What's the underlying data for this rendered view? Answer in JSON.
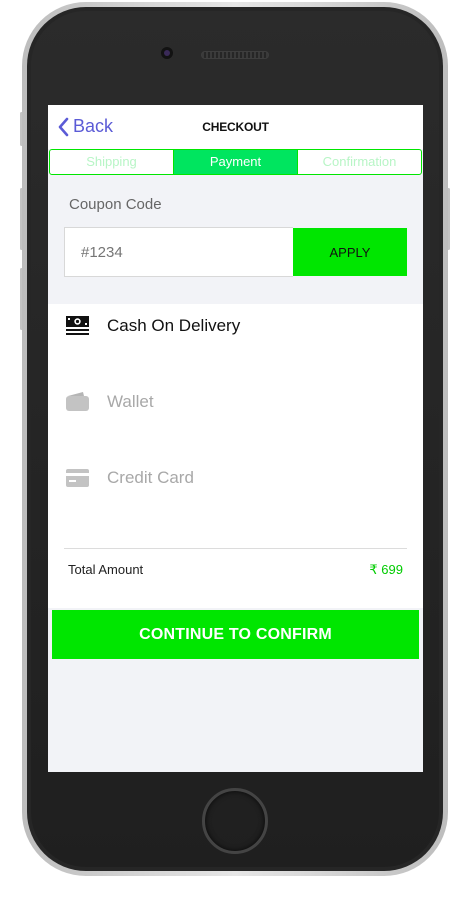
{
  "header": {
    "back_label": "Back",
    "title": "CHECKOUT"
  },
  "tabs": [
    {
      "label": "Shipping",
      "active": false
    },
    {
      "label": "Payment",
      "active": true
    },
    {
      "label": "Confirmation",
      "active": false
    }
  ],
  "coupon": {
    "label": "Coupon Code",
    "placeholder": "#1234",
    "value": "",
    "apply_label": "APPLY"
  },
  "payment_methods": [
    {
      "label": "Cash On Delivery",
      "icon": "cash-icon",
      "selected": true
    },
    {
      "label": "Wallet",
      "icon": "wallet-icon",
      "selected": false
    },
    {
      "label": "Credit Card",
      "icon": "credit-card-icon",
      "selected": false
    }
  ],
  "total": {
    "label": "Total Amount",
    "value": "₹ 699"
  },
  "continue_label": "CONTINUE TO CONFIRM",
  "colors": {
    "accent": "#00e600",
    "tab_active": "#00e55f",
    "link": "#5b5bd6",
    "screen_bg": "#f2f3f7"
  }
}
